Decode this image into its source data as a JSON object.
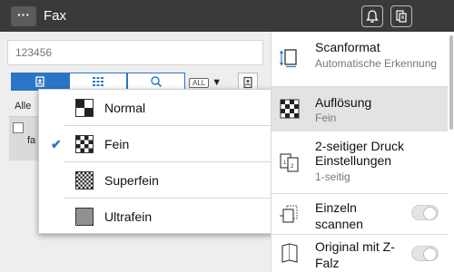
{
  "header": {
    "menu_label": "···",
    "title": "Fax"
  },
  "destination": {
    "placeholder": "123456"
  },
  "address_list": {
    "filter_all_badge": "ALL",
    "filter_caret": "▼",
    "filter_label": "Alle",
    "row_text": "fa"
  },
  "resolution_menu": {
    "selected": "Fein",
    "options": [
      {
        "label": "Normal"
      },
      {
        "label": "Fein"
      },
      {
        "label": "Superfein"
      },
      {
        "label": "Ultrafein"
      }
    ]
  },
  "settings": [
    {
      "title": "Scanformat",
      "value": "Automatische Erkennung"
    },
    {
      "title": "Auflösung",
      "value": "Fein"
    },
    {
      "title": "2-seitiger Druck Einstellungen",
      "value": "1-seitig"
    },
    {
      "title": "Einzeln scannen",
      "toggle": false
    },
    {
      "title": "Original mit Z-Falz",
      "toggle": false
    }
  ],
  "colors": {
    "accent": "#2a76c6",
    "topbar": "#3a3a3a",
    "panel": "#eeeeee"
  }
}
